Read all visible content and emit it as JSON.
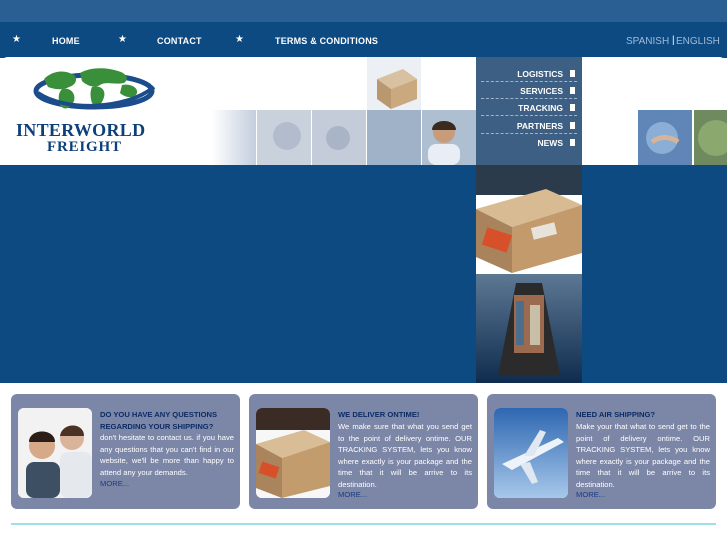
{
  "nav": {
    "star": "★",
    "home": "HOME",
    "contact": "CONTACT",
    "terms": "TERMS & CONDITIONS"
  },
  "language": {
    "spanish": "SPANISH",
    "separator": "|",
    "english": "ENGLISH"
  },
  "logo": {
    "line1": "INTERWORLD",
    "line2": "FREIGHT"
  },
  "menu": {
    "items": [
      "LOGISTICS",
      "SERVICES",
      "TRACKING",
      "PARTNERS",
      "NEWS"
    ]
  },
  "cards": [
    {
      "title": "DO YOU HAVE ANY QUESTIONS REGARDING YOUR SHIPPING?",
      "body": "don't hesitate to contact us. if you have any questions that you can't find in our website, we'll be more than happy to attend any your demands.",
      "more": "MORE..."
    },
    {
      "title": "WE DELIVER ONTIME!",
      "body": "We make sure that what you send get to the point of delivery ontime. OUR TRACKING SYSTEM, lets you know where exactly is your package and the time that it will be arrive to its destination.",
      "more": "MORE..."
    },
    {
      "title": "NEED AIR SHIPPING?",
      "body": "Make your that what to send get to the point of delivery ontime. OUR TRACKING SYSTEM, lets you know where exactly is your package and the time that it will be arrive to its destination.",
      "more": "MORE..."
    }
  ],
  "colors": {
    "nav_bg": "#0d4a82",
    "menu_bg": "#3e5f84",
    "card_bg": "#7c87a7",
    "card_title": "#0b2c66",
    "divider": "#9ee0e8"
  }
}
